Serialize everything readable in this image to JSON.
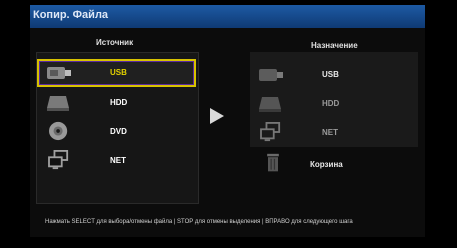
{
  "window": {
    "title": "Копир. Файла"
  },
  "source": {
    "header": "Источник",
    "items": [
      {
        "label": "USB",
        "icon": "usb-drive-icon",
        "selected": true
      },
      {
        "label": "HDD",
        "icon": "hdd-icon"
      },
      {
        "label": "DVD",
        "icon": "dvd-icon"
      },
      {
        "label": "NET",
        "icon": "network-icon"
      }
    ]
  },
  "destination": {
    "header": "Назначение",
    "items": [
      {
        "label": "USB",
        "icon": "usb-drive-icon"
      },
      {
        "label": "HDD",
        "icon": "hdd-icon"
      },
      {
        "label": "NET",
        "icon": "network-icon"
      },
      {
        "label": "Корзина",
        "icon": "trash-icon"
      }
    ]
  },
  "footer": {
    "hint": "Нажмать SELECT для выбора/отмены файла | STOP для отмены выделения | ВПРАВО для следующего шага"
  },
  "colors": {
    "selected_text": "#e3d200",
    "selection_border": "#d8c200",
    "title_bar": "#1d5aa3"
  }
}
